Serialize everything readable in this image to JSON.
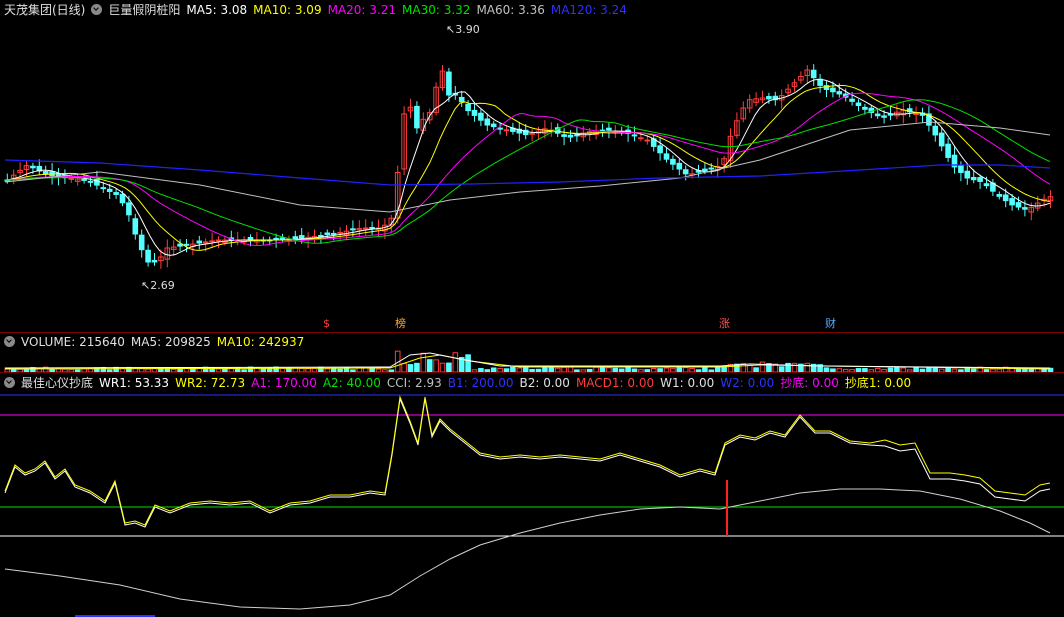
{
  "colors": {
    "up": "#ff3c3c",
    "down": "#54ffff",
    "ma5": "#ffffff",
    "ma10": "#ffff00",
    "ma20": "#ff00ff",
    "ma30": "#00e000",
    "ma60": "#c0c0c0",
    "ma120": "#2020ff"
  },
  "header": {
    "stock": "天茂集团(日线)",
    "indicator_name": "巨量假阴桩阳",
    "ma5": "MA5: 3.08",
    "ma10": "MA10: 3.09",
    "ma20": "MA20: 3.21",
    "ma30": "MA30: 3.32",
    "ma60": "MA60: 3.36",
    "ma120": "MA120: 3.24"
  },
  "price_annotations": {
    "high": "3.90",
    "low": "2.69"
  },
  "events": [
    {
      "label": "$",
      "color": "#ff3c3c"
    },
    {
      "label": "榜",
      "color": "#ffaa33"
    },
    {
      "label": "涨",
      "color": "#ff5555"
    },
    {
      "label": "财",
      "color": "#55aaff"
    }
  ],
  "volume_header": {
    "volume": "VOLUME: 215640",
    "ma5": "MA5: 209825",
    "ma10": "MA10: 242937"
  },
  "indicator_header": {
    "name": "最佳心仪抄底",
    "wr1": "WR1: 53.33",
    "wr2": "WR2: 72.73",
    "a1": "A1: 170.00",
    "a2": "A2: 40.00",
    "cci": "CCI: 2.93",
    "b1": "B1: 200.00",
    "b2": "B2: 0.00",
    "macd1": "MACD1: 0.00",
    "w1": "W1: 0.00",
    "w2": "W2: 0.00",
    "chaodi": "抄底: 0.00",
    "chaodi1": "抄底1: 0.00"
  }
}
